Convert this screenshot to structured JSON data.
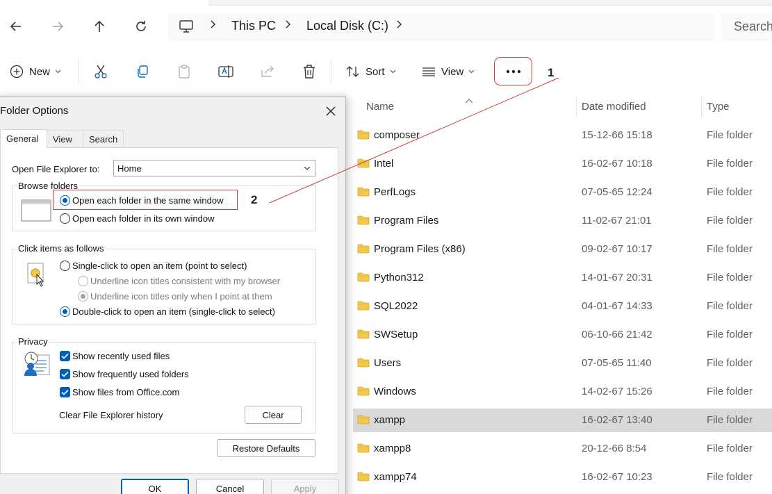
{
  "colors": {
    "accent": "#005fb8",
    "annotation_red": "#d53b3b",
    "folder_yellow": "#f2c94c",
    "selected_row": "#d9d9d9"
  },
  "address_bar": {
    "icons": [
      "back-arrow-icon",
      "forward-arrow-icon",
      "up-arrow-icon",
      "refresh-icon",
      "computer-icon"
    ],
    "breadcrumbs": [
      "This PC",
      "Local Disk (C:)"
    ],
    "search_placeholder": "Search"
  },
  "toolbar": {
    "new_label": "New",
    "sort_label": "Sort",
    "view_label": "View",
    "icons": [
      "cut-icon",
      "copy-icon",
      "paste-icon",
      "rename-icon",
      "share-icon",
      "delete-icon",
      "more-options-icon"
    ]
  },
  "annotations": {
    "marker_1": "1",
    "marker_2": "2"
  },
  "file_list": {
    "columns": [
      "Name",
      "Date modified",
      "Type"
    ],
    "rows": [
      {
        "name": "composer",
        "date": "15-12-66 15:18",
        "type": "File folder"
      },
      {
        "name": "Intel",
        "date": "16-02-67 10:18",
        "type": "File folder"
      },
      {
        "name": "PerfLogs",
        "date": "07-05-65 12:24",
        "type": "File folder"
      },
      {
        "name": "Program Files",
        "date": "11-02-67 21:01",
        "type": "File folder"
      },
      {
        "name": "Program Files (x86)",
        "date": "09-02-67 10:17",
        "type": "File folder"
      },
      {
        "name": "Python312",
        "date": "14-01-67 20:31",
        "type": "File folder"
      },
      {
        "name": "SQL2022",
        "date": "04-01-67 14:33",
        "type": "File folder"
      },
      {
        "name": "SWSetup",
        "date": "06-10-66 21:42",
        "type": "File folder"
      },
      {
        "name": "Users",
        "date": "07-05-65 11:40",
        "type": "File folder"
      },
      {
        "name": "Windows",
        "date": "14-02-67 15:26",
        "type": "File folder"
      },
      {
        "name": "xampp",
        "date": "16-02-67 13:40",
        "type": "File folder"
      },
      {
        "name": "xampp8",
        "date": "20-12-66 8:54",
        "type": "File folder"
      },
      {
        "name": "xampp74",
        "date": "16-02-67 10:23",
        "type": "File folder"
      }
    ],
    "selected_row": "xampp"
  },
  "dialog": {
    "title": "Folder Options",
    "tabs": [
      "General",
      "View",
      "Search"
    ],
    "active_tab": "General",
    "open_explorer_label": "Open File Explorer to:",
    "open_explorer_value": "Home",
    "browse_folders": {
      "title": "Browse folders",
      "option_same": "Open each folder in the same window",
      "option_own": "Open each folder in its own window",
      "selected": "same"
    },
    "click_items": {
      "title": "Click items as follows",
      "single_click": "Single-click to open an item (point to select)",
      "underline_browser": "Underline icon titles consistent with my browser",
      "underline_point": "Underline icon titles only when I point at them",
      "double_click": "Double-click to open an item (single-click to select)",
      "selected": "double"
    },
    "privacy": {
      "title": "Privacy",
      "recent_files": "Show recently used files",
      "frequent_folders": "Show frequently used folders",
      "office_files": "Show files from Office.com",
      "clear_history_label": "Clear File Explorer history",
      "clear_button": "Clear"
    },
    "restore_defaults": "Restore Defaults",
    "ok": "OK",
    "cancel": "Cancel",
    "apply": "Apply"
  }
}
